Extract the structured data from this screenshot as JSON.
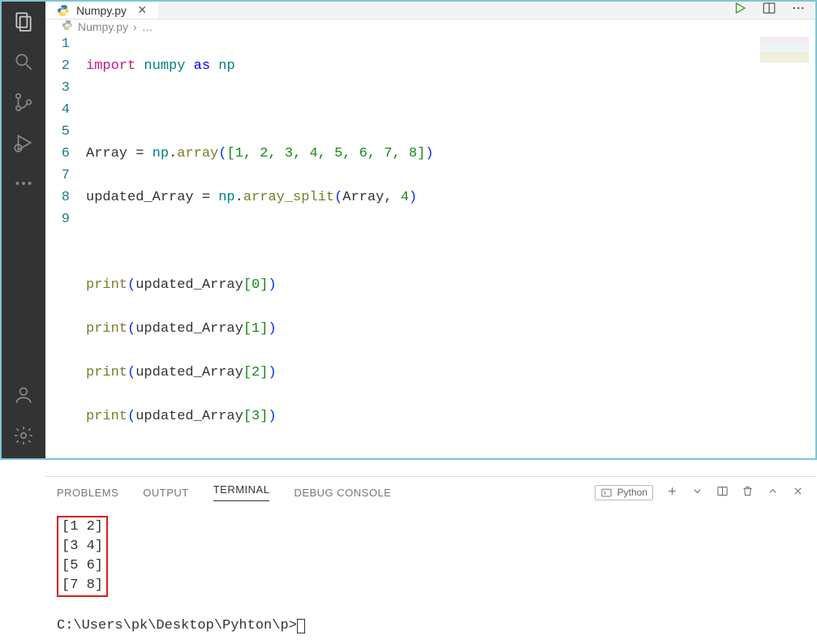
{
  "tabs": {
    "filename": "Numpy.py"
  },
  "breadcrumb": {
    "filename": "Numpy.py",
    "sep": "›",
    "more": "…"
  },
  "editor": {
    "lines": [
      "1",
      "2",
      "3",
      "4",
      "5",
      "6",
      "7",
      "8",
      "9"
    ],
    "code": {
      "l1_import": "import",
      "l1_numpy": "numpy",
      "l1_as": "as",
      "l1_np": "np",
      "l3_array": "Array",
      "l3_eq": " = ",
      "l3_np": "np",
      "l3_dot": ".",
      "l3_fn": "array",
      "l3_nums": "1, 2, 3, 4, 5, 6, 7, 8",
      "l4_var": "updated_Array",
      "l4_eq": " = ",
      "l4_np": "np",
      "l4_fn": "array_split",
      "l4_arg1": "Array",
      "l4_comma": ", ",
      "l4_arg2": "4",
      "l6_fn": "print",
      "l6_var": "updated_Array",
      "l6_idx": "0",
      "l7_idx": "1",
      "l8_idx": "2",
      "l9_idx": "3"
    }
  },
  "panel": {
    "tabs": {
      "problems": "PROBLEMS",
      "output": "OUTPUT",
      "terminal": "TERMINAL",
      "debug": "DEBUG CONSOLE"
    },
    "interpreter": "Python"
  },
  "terminal": {
    "out1": "[1 2]",
    "out2": "[3 4]",
    "out3": "[5 6]",
    "out4": "[7 8]",
    "prompt": "C:\\Users\\pk\\Desktop\\Pyhton\\p>"
  }
}
